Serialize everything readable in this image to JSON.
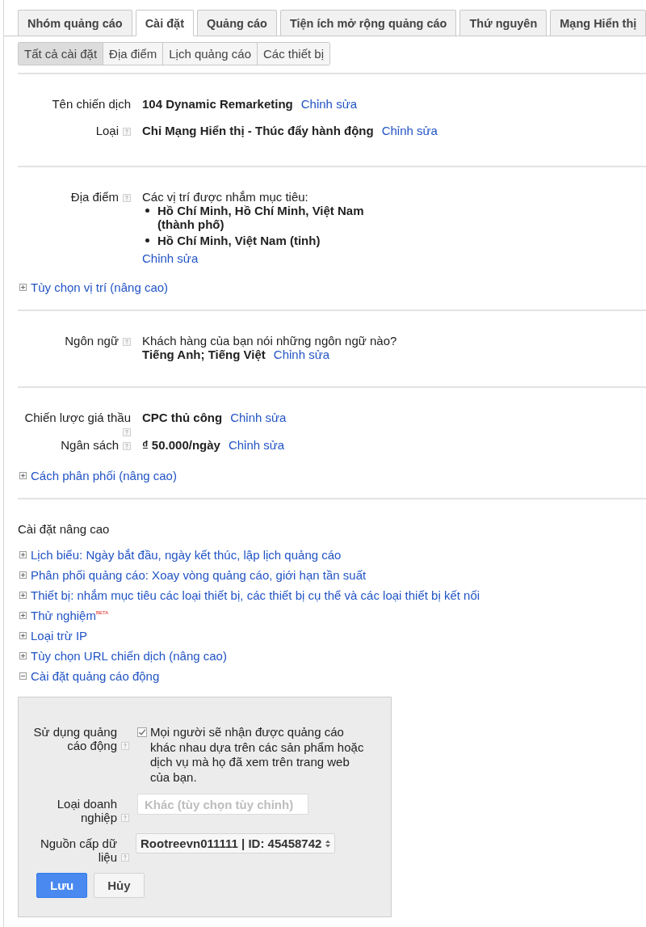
{
  "tabs": [
    {
      "label": "Nhóm quảng cáo",
      "selected": false
    },
    {
      "label": "Cài đặt",
      "selected": true
    },
    {
      "label": "Quảng cáo",
      "selected": false
    },
    {
      "label": "Tiện ích mở rộng quảng cáo",
      "selected": false
    },
    {
      "label": "Thứ nguyên",
      "selected": false
    },
    {
      "label": "Mạng Hiển thị",
      "selected": false
    }
  ],
  "subtabs": [
    {
      "label": "Tất cả cài đặt",
      "selected": true
    },
    {
      "label": "Địa điểm",
      "selected": false
    },
    {
      "label": "Lịch quảng cáo",
      "selected": false
    },
    {
      "label": "Các thiết bị",
      "selected": false
    }
  ],
  "sections": [
    {
      "rows": [
        {
          "kind": "value",
          "label": "Tên chiến dịch",
          "help": false,
          "value": "104 Dynamic Remarketing",
          "link": "Chỉnh sửa"
        },
        {
          "kind": "value",
          "label": "Loại",
          "help": true,
          "value": "Chỉ Mạng Hiển thị - Thúc đẩy hành động",
          "link": "Chỉnh sửa"
        }
      ]
    },
    {
      "rows": [
        {
          "kind": "list",
          "label": "Địa điểm",
          "help": true,
          "intro": "Các vị trí được nhắm mục tiêu:",
          "items": [
            "Hồ Chí Minh, Hồ Chí Minh, Việt Nam (thành phố)",
            "Hồ Chí Minh, Việt Nam (tỉnh)"
          ],
          "link": "Chỉnh sửa"
        }
      ],
      "expander": {
        "label": "Tùy chọn vị trí (nâng cao)",
        "expanded": false
      }
    },
    {
      "rows": [
        {
          "kind": "question",
          "label": "Ngôn ngữ",
          "help": true,
          "question": "Khách hàng của bạn nói những ngôn ngữ nào?",
          "value": "Tiếng Anh; Tiếng Việt",
          "link": "Chỉnh sửa"
        }
      ]
    },
    {
      "rows": [
        {
          "kind": "value",
          "label": "Chiến lược giá thầu",
          "help": true,
          "value": "CPC thủ công",
          "link": "Chỉnh sửa"
        },
        {
          "kind": "value",
          "label": "Ngân sách",
          "help": true,
          "value": "₫ 50.000/ngày",
          "link": "Chỉnh sửa"
        }
      ],
      "expander": {
        "label": "Cách phân phối (nâng cao)",
        "expanded": false
      }
    }
  ],
  "advanced": {
    "title": "Cài đặt nâng cao",
    "items": [
      {
        "label": "Lịch biểu: Ngày bắt đầu, ngày kết thúc, lập lịch quảng cáo",
        "expanded": false
      },
      {
        "label": "Phân phối quảng cáo: Xoay vòng quảng cáo, giới hạn tần suất",
        "expanded": false
      },
      {
        "label": "Thiết bị: nhắm mục tiêu các loại thiết bị, các thiết bị cụ thể và các loại thiết bị kết nối",
        "expanded": false
      },
      {
        "label": "Thử nghiệm$^{BETA}$",
        "expanded": false
      },
      {
        "label": "Loại trừ IP",
        "expanded": false
      },
      {
        "label": "Tùy chọn URL chiến dịch (nâng cao)",
        "expanded": false
      },
      {
        "label": "Cài đặt quảng cáo động",
        "expanded": true
      }
    ]
  },
  "dynamic_ads": {
    "rows": [
      {
        "kind": "checkbox",
        "label": "Sử dụng quảng cáo động",
        "help": true,
        "checked": true,
        "text": "Mọi người sẽ nhận được quảng cáo khác nhau dựa trên các sản phẩm hoặc dịch vụ mà họ đã xem trên trang web của bạn."
      },
      {
        "kind": "field",
        "label": "Loại doanh nghiệp",
        "help": true,
        "value": "Khác (tùy chọn tùy chỉnh)",
        "disabled": true
      },
      {
        "kind": "select",
        "label": "Nguồn cấp dữ liệu",
        "help": true,
        "value": "Rootreevn011111 | ID: 45458742"
      }
    ],
    "buttons": [
      {
        "label": "Lưu",
        "kind": "primary"
      },
      {
        "label": "Hủy",
        "kind": "secondary"
      }
    ]
  }
}
